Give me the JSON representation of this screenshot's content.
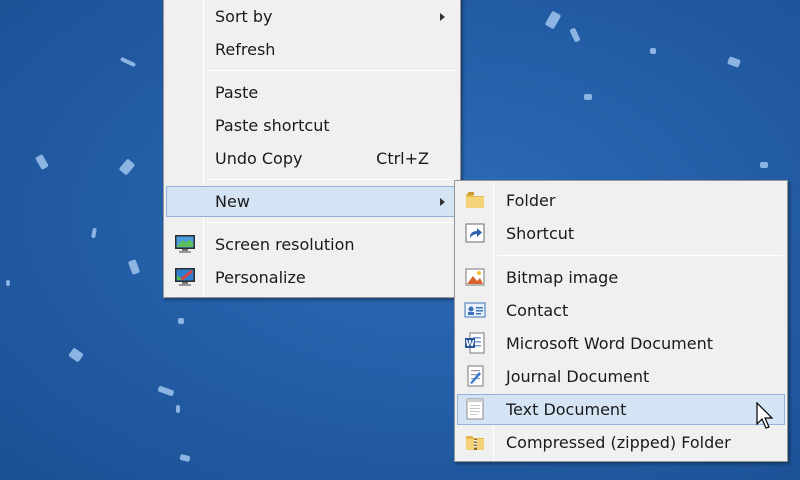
{
  "context_menu": {
    "items": [
      {
        "label": "Sort by",
        "has_submenu": true
      },
      {
        "label": "Refresh"
      },
      {
        "label": "Paste"
      },
      {
        "label": "Paste shortcut"
      },
      {
        "label": "Undo Copy",
        "shortcut": "Ctrl+Z"
      },
      {
        "label": "New",
        "has_submenu": true,
        "highlighted": true
      },
      {
        "label": "Screen resolution",
        "icon": "monitor-icon"
      },
      {
        "label": "Personalize",
        "icon": "personalize-icon"
      }
    ]
  },
  "new_submenu": {
    "items": [
      {
        "label": "Folder",
        "icon": "folder-icon"
      },
      {
        "label": "Shortcut",
        "icon": "shortcut-icon"
      },
      {
        "label": "Bitmap image",
        "icon": "bitmap-icon"
      },
      {
        "label": "Contact",
        "icon": "contact-icon"
      },
      {
        "label": "Microsoft Word Document",
        "icon": "word-document-icon"
      },
      {
        "label": "Journal Document",
        "icon": "journal-document-icon"
      },
      {
        "label": "Text Document",
        "icon": "text-document-icon",
        "highlighted": true
      },
      {
        "label": "Compressed (zipped) Folder",
        "icon": "zip-folder-icon"
      }
    ]
  },
  "colors": {
    "menu_background": "#f0f0f0",
    "highlight_background": "#d5e4f5",
    "highlight_border": "#8fb3de",
    "desktop_background": "#245fa8"
  }
}
